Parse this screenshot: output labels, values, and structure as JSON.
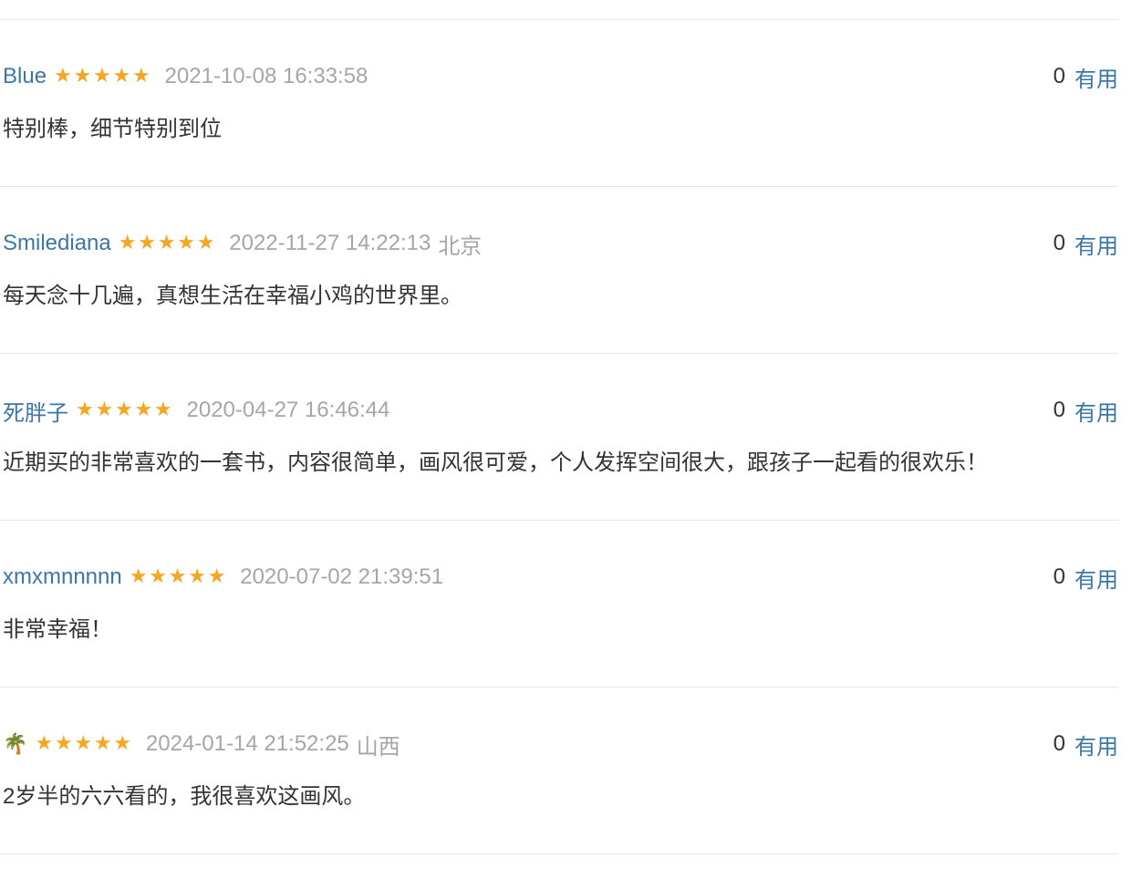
{
  "comments": [
    {
      "user": "Blue",
      "rating_stars": 5,
      "time": "2021-10-08 16:33:58",
      "location": "",
      "text": "特别棒，细节特别到位",
      "vote_count": "0",
      "useful_label": "有用"
    },
    {
      "user": "Smilediana",
      "rating_stars": 5,
      "time": "2022-11-27 14:22:13",
      "location": "北京",
      "text": "每天念十几遍，真想生活在幸福小鸡的世界里。",
      "vote_count": "0",
      "useful_label": "有用"
    },
    {
      "user": "死胖子",
      "rating_stars": 5,
      "time": "2020-04-27 16:46:44",
      "location": "",
      "text": "近期买的非常喜欢的一套书，内容很简单，画风很可爱，个人发挥空间很大，跟孩子一起看的很欢乐！",
      "vote_count": "0",
      "useful_label": "有用"
    },
    {
      "user": "xmxmnnnnn",
      "rating_stars": 5,
      "time": "2020-07-02 21:39:51",
      "location": "",
      "text": "非常幸福！",
      "vote_count": "0",
      "useful_label": "有用"
    },
    {
      "user": "🌴",
      "user_icon": "palm-tree-icon",
      "rating_stars": 5,
      "time": "2024-01-14 21:52:25",
      "location": "山西",
      "text": "2岁半的六六看的，我很喜欢这画风。",
      "vote_count": "0",
      "useful_label": "有用"
    }
  ],
  "colors": {
    "link": "#3a77a8",
    "star": "#f5a623",
    "muted": "#a6a6a6",
    "text": "#333333",
    "divider": "#e6e6e6"
  }
}
